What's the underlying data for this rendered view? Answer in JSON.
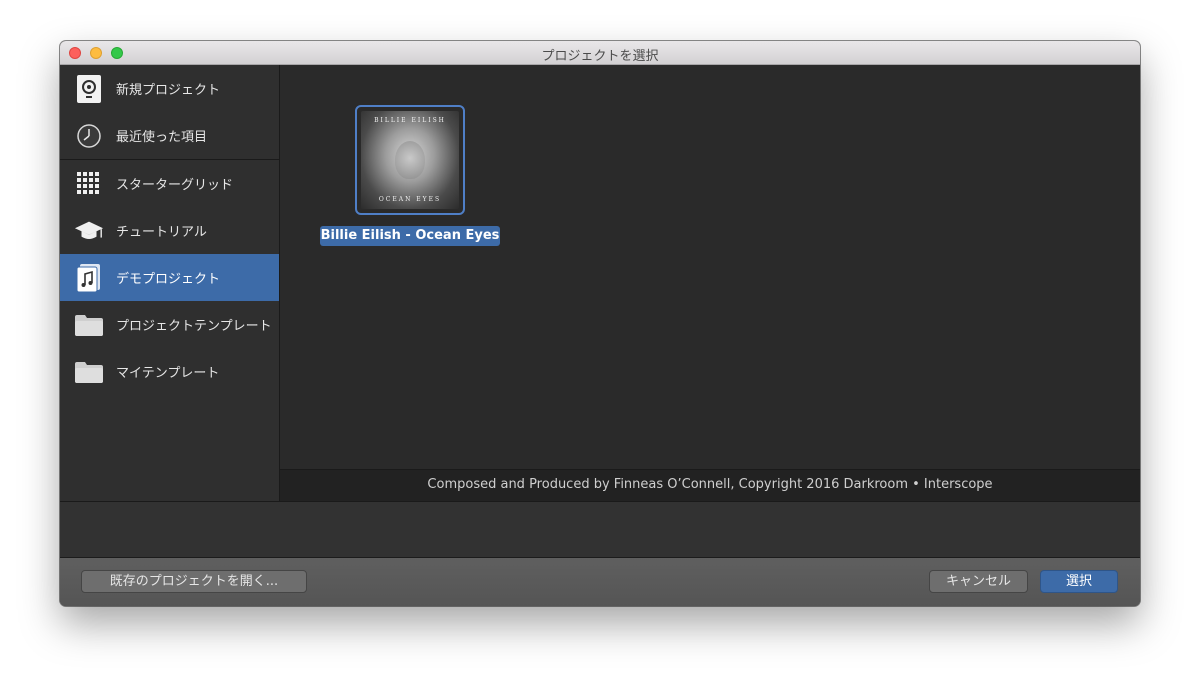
{
  "window": {
    "title": "プロジェクトを選択"
  },
  "sidebar": {
    "items": [
      {
        "label": "新規プロジェクト",
        "icon": "new-project-icon"
      },
      {
        "label": "最近使った項目",
        "icon": "clock-icon"
      },
      {
        "label": "スターターグリッド",
        "icon": "grid-icon"
      },
      {
        "label": "チュートリアル",
        "icon": "graduation-cap-icon"
      },
      {
        "label": "デモプロジェクト",
        "icon": "music-document-icon",
        "selected": true
      },
      {
        "label": "プロジェクトテンプレート",
        "icon": "folder-icon"
      },
      {
        "label": "マイテンプレート",
        "icon": "folder-icon"
      }
    ]
  },
  "main": {
    "project": {
      "name": "Billie Eilish - Ocean Eyes",
      "art_top": "BILLIE EILISH",
      "art_bottom": "OCEAN EYES"
    },
    "description": "Composed and Produced by Finneas O’Connell, Copyright 2016 Darkroom • Interscope"
  },
  "footer": {
    "open_label": "既存のプロジェクトを開く...",
    "cancel_label": "キャンセル",
    "select_label": "選択"
  },
  "colors": {
    "selection": "#3d6ba8",
    "sidebar_bg": "#2f2f2f",
    "content_bg": "#2a2a2a"
  }
}
